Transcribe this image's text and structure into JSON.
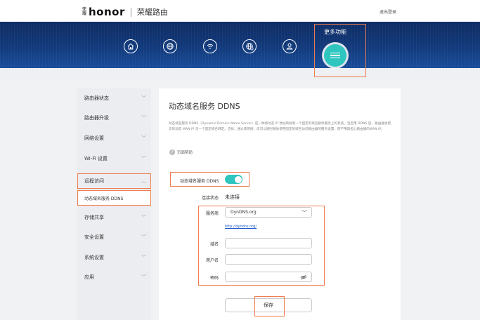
{
  "header": {
    "brand_mark": "荣耀",
    "brand_word": "honor",
    "brand_cn": "荣耀路由",
    "logout": "退出登录"
  },
  "nav": {
    "icons": [
      "home-icon",
      "globe-icon",
      "wifi-icon",
      "devices-icon",
      "user-icon"
    ],
    "more_label": "更多功能"
  },
  "sidebar": {
    "items": [
      {
        "label": "路由器状态"
      },
      {
        "label": "路由器升级"
      },
      {
        "label": "网络设置"
      },
      {
        "label": "Wi-Fi 设置"
      },
      {
        "label": "远程访问"
      },
      {
        "label": "动态域名服务 DDNS"
      },
      {
        "label": "存储共享"
      },
      {
        "label": "安全设置"
      },
      {
        "label": "系统设置"
      },
      {
        "label": "应用"
      }
    ]
  },
  "main": {
    "title": "动态域名服务 DDNS",
    "description": "动态域名服务 DDNS（Dynamic Domain Name Server）是一种将动态 IP 地址映射到一个固定的域名解析服务上的系统。当启用 DDNS 后，路由器会把您的动态 WAN IP 与一个固定域名绑定。这样，通过该网络，您可以随时随地使用固定的域名访问路由器的服务设置，而不用再担心路由器的WAN IP。",
    "help_text": "页面帮助",
    "toggle_label": "动态域名服务 DDNS",
    "toggle_on": true,
    "status_label": "连接状态",
    "status_value": "未连接",
    "provider_label": "服务商",
    "provider_value": "DynDNS.org",
    "provider_link": "http://dyndns.org/",
    "domain_label": "域名",
    "domain_value": "",
    "username_label": "用户名",
    "username_value": "",
    "password_label": "密码",
    "password_value": "",
    "save_label": "保存"
  },
  "colors": {
    "accent": "#2fc6c0",
    "highlight": "#ef7d4f",
    "hero": "#123a7c",
    "link": "#1a59c9"
  }
}
